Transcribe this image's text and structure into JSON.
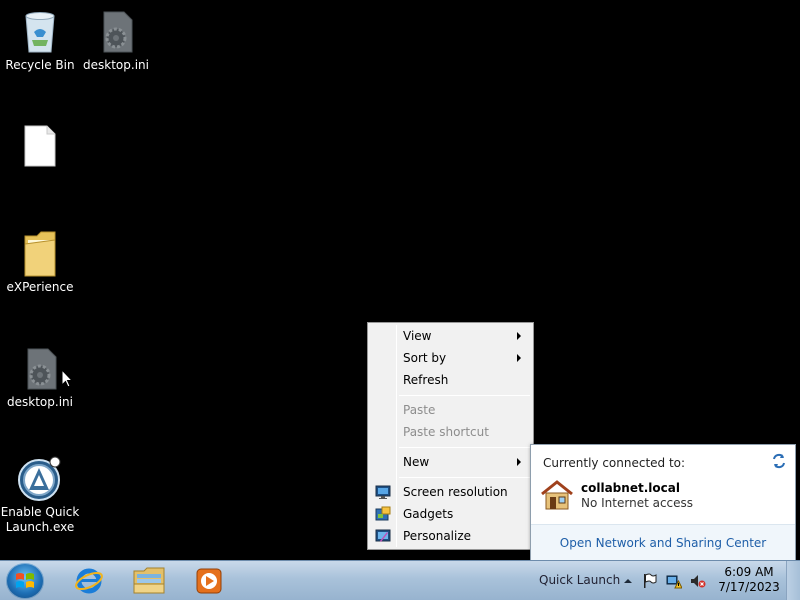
{
  "desktop": {
    "icons": [
      {
        "label": "Recycle Bin"
      },
      {
        "label": "desktop.ini"
      },
      {
        "label": ""
      },
      {
        "label": "eXPerience"
      },
      {
        "label": "desktop.ini"
      },
      {
        "label": "Enable Quick\nLaunch.exe"
      }
    ]
  },
  "context_menu": {
    "items": [
      {
        "label": "View",
        "submenu": true,
        "enabled": true
      },
      {
        "label": "Sort by",
        "submenu": true,
        "enabled": true
      },
      {
        "label": "Refresh",
        "enabled": true
      },
      {
        "label": "Paste",
        "enabled": false
      },
      {
        "label": "Paste shortcut",
        "enabled": false
      },
      {
        "label": "New",
        "submenu": true,
        "enabled": true
      },
      {
        "label": "Screen resolution",
        "icon": "monitor-icon",
        "enabled": true
      },
      {
        "label": "Gadgets",
        "icon": "gadgets-icon",
        "enabled": true
      },
      {
        "label": "Personalize",
        "icon": "personalize-icon",
        "enabled": true
      }
    ]
  },
  "network_flyout": {
    "header": "Currently connected to:",
    "network_name": "collabnet.local",
    "status": "No Internet access",
    "footer_link": "Open Network and Sharing Center"
  },
  "taskbar": {
    "quick_launch_label": "Quick Launch",
    "time": "6:09 AM",
    "date": "7/17/2023",
    "apps": [
      "internet-explorer-icon",
      "file-explorer-icon",
      "media-player-icon"
    ]
  },
  "colors": {
    "desktop_bg": "#000000",
    "link": "#1e5ea8"
  }
}
